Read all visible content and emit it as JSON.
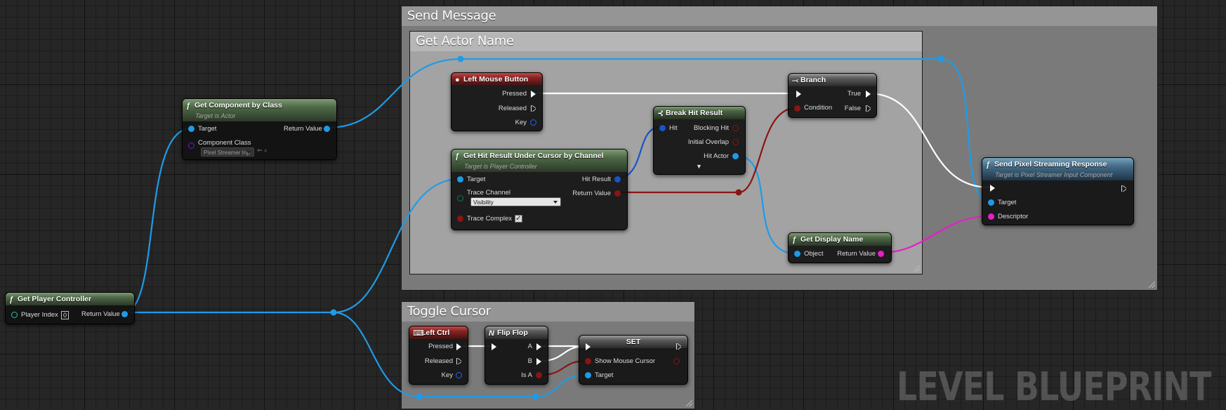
{
  "comments": {
    "send_message": "Send Message",
    "get_actor_name": "Get Actor Name",
    "toggle_cursor": "Toggle Cursor"
  },
  "nodes": {
    "get_player_controller": {
      "title": "Get Player Controller",
      "player_index_label": "Player Index",
      "player_index_value": "0",
      "return_value": "Return Value"
    },
    "get_component_by_class": {
      "title": "Get Component by Class",
      "subtitle": "Target is Actor",
      "target": "Target",
      "return_value": "Return Value",
      "component_class": "Component Class",
      "class_value": "Pixel Streamer Inp"
    },
    "left_mouse_button": {
      "title": "Left Mouse Button",
      "pressed": "Pressed",
      "released": "Released",
      "key": "Key"
    },
    "get_hit_result": {
      "title": "Get Hit Result Under Cursor by Channel",
      "subtitle": "Target is Player Controller",
      "target": "Target",
      "hit_result": "Hit Result",
      "trace_channel": "Trace Channel",
      "channel_value": "Visibility",
      "return_value": "Return Value",
      "trace_complex": "Trace Complex"
    },
    "break_hit_result": {
      "title": "Break Hit Result",
      "hit": "Hit",
      "blocking_hit": "Blocking Hit",
      "initial_overlap": "Initial Overlap",
      "hit_actor": "Hit Actor"
    },
    "branch": {
      "title": "Branch",
      "true": "True",
      "false": "False",
      "condition": "Condition"
    },
    "get_display_name": {
      "title": "Get Display Name",
      "object": "Object",
      "return_value": "Return Value"
    },
    "send_pixel_streaming_response": {
      "title": "Send Pixel Streaming Response",
      "subtitle": "Target is Pixel Streamer Input Component",
      "target": "Target",
      "descriptor": "Descriptor"
    },
    "left_ctrl": {
      "title": "Left Ctrl",
      "pressed": "Pressed",
      "released": "Released",
      "key": "Key"
    },
    "flip_flop": {
      "title": "Flip Flop",
      "a": "A",
      "b": "B",
      "is_a": "Is A"
    },
    "set": {
      "title": "SET",
      "show_mouse_cursor": "Show Mouse Cursor",
      "target": "Target"
    }
  },
  "watermark": "LEVEL BLUEPRINT",
  "colors": {
    "object_wire": "#1e9be8",
    "bool_wire": "#8a1414",
    "string_wire": "#e81ec8",
    "exec_wire": "#ffffff",
    "struct_wire": "#1655c8",
    "class_pin": "#6a1fc8"
  }
}
